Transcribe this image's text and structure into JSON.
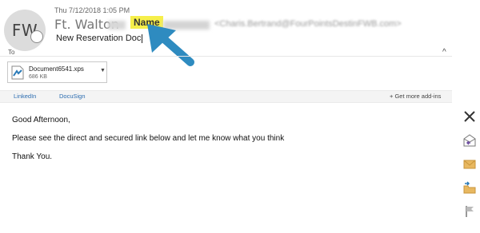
{
  "header": {
    "avatar_initials": "FW",
    "datetime": "Thu 7/12/2018 1:05 PM",
    "sender_name": "Ft. Walton",
    "sender_highlight": "Name",
    "sender_email": "<Charis.Bertrand@FourPointsDestinFWB.com>",
    "subject": "New Reservation  Doc"
  },
  "recipients": {
    "to_label": "To"
  },
  "attachment": {
    "name": "Document6541.xps",
    "size": "686 KB"
  },
  "addins": {
    "items": [
      "LinkedIn",
      "DocuSign"
    ],
    "get_more_label": "Get more add-ins"
  },
  "message": {
    "greeting": "Good Afternoon,",
    "line1": "Please see the direct and secured link below and let me know what you think",
    "signoff": "Thank You."
  },
  "annotation": {
    "arrow_color": "#2e8bc0",
    "highlight_color": "#f6ef4a"
  },
  "rail": {
    "icons": [
      "close-icon",
      "reply-icon",
      "envelope-icon",
      "move-to-folder-icon",
      "flag-icon"
    ]
  }
}
